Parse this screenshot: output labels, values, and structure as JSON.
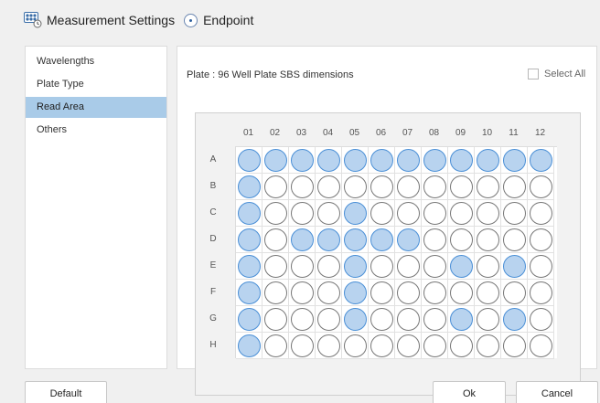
{
  "header": {
    "title": "Measurement Settings",
    "mode_label": "Endpoint"
  },
  "sidebar": {
    "items": [
      {
        "label": "Wavelengths",
        "active": false
      },
      {
        "label": "Plate Type",
        "active": false
      },
      {
        "label": "Read Area",
        "active": true
      },
      {
        "label": "Others",
        "active": false
      }
    ]
  },
  "main": {
    "plate_label": "Plate : 96 Well Plate SBS dimensions",
    "select_all_label": "Select All",
    "select_all_checked": false,
    "columns": [
      "01",
      "02",
      "03",
      "04",
      "05",
      "06",
      "07",
      "08",
      "09",
      "10",
      "11",
      "12"
    ],
    "rows": [
      "A",
      "B",
      "C",
      "D",
      "E",
      "F",
      "G",
      "H"
    ],
    "selected_wells": {
      "A": [
        1,
        2,
        3,
        4,
        5,
        6,
        7,
        8,
        9,
        10,
        11,
        12
      ],
      "B": [
        1
      ],
      "C": [
        1,
        5
      ],
      "D": [
        1,
        3,
        4,
        5,
        6,
        7
      ],
      "E": [
        1,
        5,
        9,
        11
      ],
      "F": [
        1,
        5
      ],
      "G": [
        1,
        5,
        9,
        11
      ],
      "H": [
        1
      ]
    },
    "colors": {
      "selected_fill": "#b8d3ef",
      "selected_border": "#4a8fd6",
      "sidebar_active": "#a9cbe8"
    }
  },
  "footer": {
    "default_label": "Default",
    "ok_label": "Ok",
    "cancel_label": "Cancel"
  }
}
